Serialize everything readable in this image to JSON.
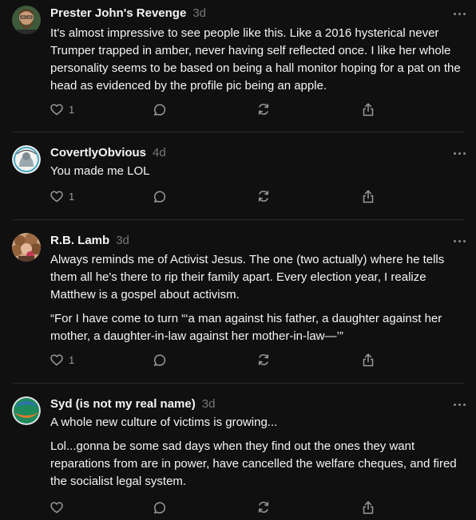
{
  "comments": [
    {
      "author": "Prester John's Revenge",
      "time": "3d",
      "paragraphs": [
        "It's almost impressive to see people like this. Like a 2016 hysterical never Trumper trapped in amber, never having self reflected once. I like her whole personality seems to be based on being a hall monitor hoping for a pat on the head as evidenced by the profile pic being an apple."
      ],
      "like_count": "1"
    },
    {
      "author": "CovertlyObvious",
      "time": "4d",
      "paragraphs": [
        "You made me LOL"
      ],
      "like_count": "1"
    },
    {
      "author": "R.B. Lamb",
      "time": "3d",
      "paragraphs": [
        "Always reminds me of Activist Jesus. The one (two actually) where he tells them all he's there to rip their family apart. Every election year, I realize Matthew is a gospel about activism.",
        "“For I have come to turn “‘a man against his father, a daughter against her mother, a daughter-in-law against her mother-in-law—’”"
      ],
      "like_count": "1"
    },
    {
      "author": "Syd (is not my real name)",
      "time": "3d",
      "paragraphs": [
        "A whole new culture of victims is growing...",
        "Lol...gonna be some sad days when they find out the ones they want reparations from are in power, have cancelled the welfare cheques, and fired the socialist legal system."
      ],
      "like_count": ""
    }
  ],
  "icons": {
    "like": "heart-icon",
    "reply": "speech-bubble-icon",
    "restack": "restack-arrows-icon",
    "share": "share-icon",
    "more": "more-dots-icon"
  },
  "colors": {
    "background": "#101010",
    "text": "#f3f5f7",
    "muted": "#777777",
    "divider": "#2a2a2a"
  }
}
